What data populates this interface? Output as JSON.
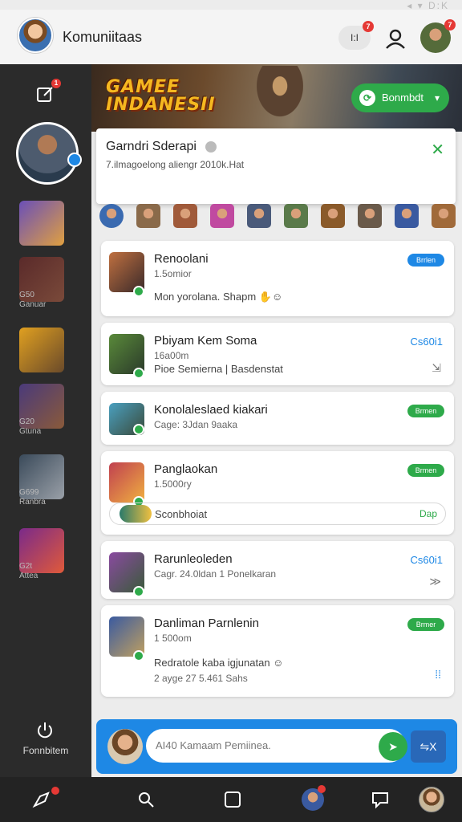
{
  "status_bar": {
    "icons_text": "◂ ▾ D:K"
  },
  "header": {
    "title": "Komuniitaas",
    "msg_button_label": "I:I",
    "msg_badge": "7",
    "profile_badge": "7"
  },
  "sidebar": {
    "edit_badge": "1",
    "games": [
      {
        "label": "",
        "icon": "lightning-hero-game-icon",
        "colors": [
          "#6a4fb8",
          "#e0a040"
        ]
      },
      {
        "label": "G50\nGanuar",
        "icon": "warrior-game-icon",
        "colors": [
          "#5a2a2a",
          "#7a4a3a"
        ]
      },
      {
        "label": "",
        "icon": "golden-knight-game-icon",
        "colors": [
          "#e0a020",
          "#6a4a2a"
        ]
      },
      {
        "label": "G20\nGtuna",
        "icon": "armored-hero-game-icon",
        "colors": [
          "#4a3a7a",
          "#8a5a3a"
        ]
      },
      {
        "label": "G699\nRanbra",
        "icon": "masked-fighter-game-icon",
        "colors": [
          "#3a4a5a",
          "#9aa0a8"
        ]
      },
      {
        "label": "G2t\nAttea",
        "icon": "villain-game-icon",
        "colors": [
          "#7a2a8a",
          "#e05a3a"
        ]
      }
    ],
    "bottom_label": "Fonnbitem"
  },
  "banner": {
    "logo_line1": "GAMEE",
    "logo_line2": "INDANESII",
    "button_label": "Bonmbdt"
  },
  "popup": {
    "title": "Garndri Sderapi",
    "subtitle": "7.ilmagoelong aliengr 2010k.Hat"
  },
  "avatar_row": {
    "colors": [
      "#3a6ab0",
      "#8a6a4a",
      "#a05a3a",
      "#c04aa0",
      "#4a5a7a",
      "#5a7a4a",
      "#8a5a2a",
      "#6a5a4a",
      "#3a5aa0",
      "#a06a3a"
    ]
  },
  "cards": [
    {
      "title": "Renoolani",
      "sub": "1.5omior",
      "extra": "Mon yorolana. Shapm ✋☺",
      "tag": "Brrlen",
      "tag_color": "#1e88e5",
      "thumb": [
        "#c07040",
        "#3a2a2a"
      ]
    },
    {
      "title": "Pbiyam Kem Soma",
      "sub": "16a00m",
      "extra": "Pioe Semierna | Basdenstat",
      "action": "Cs60i1",
      "action_icon": "⇲",
      "thumb": [
        "#5a8a3a",
        "#2a3a2a"
      ]
    },
    {
      "title": "Konolaleslaed kiakari",
      "sub": "Cage: 3Jdan 9aaka",
      "tag": "Brmen",
      "tag_color": "#2eaa4a",
      "thumb": [
        "#4aa0c0",
        "#3a4a3a"
      ]
    },
    {
      "title": "Panglaokan",
      "sub": "1.5000ry",
      "extra": "Sconbhoiat",
      "extra_action": "Dap",
      "tag": "Brmen",
      "tag_color": "#2eaa4a",
      "thumb": [
        "#c04050",
        "#f0b040"
      ]
    },
    {
      "title": "Rarunleoleden",
      "sub": "Cagr. 24.0ldan 1 Ponelkaran",
      "action": "Cs60i1",
      "action_icon": "≫",
      "thumb": [
        "#8a4aa0",
        "#3a5a3a"
      ]
    },
    {
      "title": "Danliman Parnlenin",
      "sub": "1 500om",
      "extra": "Redratole kaba igjunatan ☺",
      "extra_sub": "2 ayge 27 5.461 Sahs",
      "tag": "Brmer",
      "tag_color": "#2eaa4a",
      "thumb": [
        "#3a5aa0",
        "#c0a060"
      ]
    }
  ],
  "composer": {
    "placeholder": "AI40 Kamaam Pemiinea.",
    "send_icon": "➤",
    "secondary_label": "⇋X"
  },
  "bottom_nav": {
    "items": [
      "rocket-icon",
      "search-icon",
      "square-icon",
      "profile-icon",
      "chat-icon",
      "user-avatar-icon"
    ]
  }
}
